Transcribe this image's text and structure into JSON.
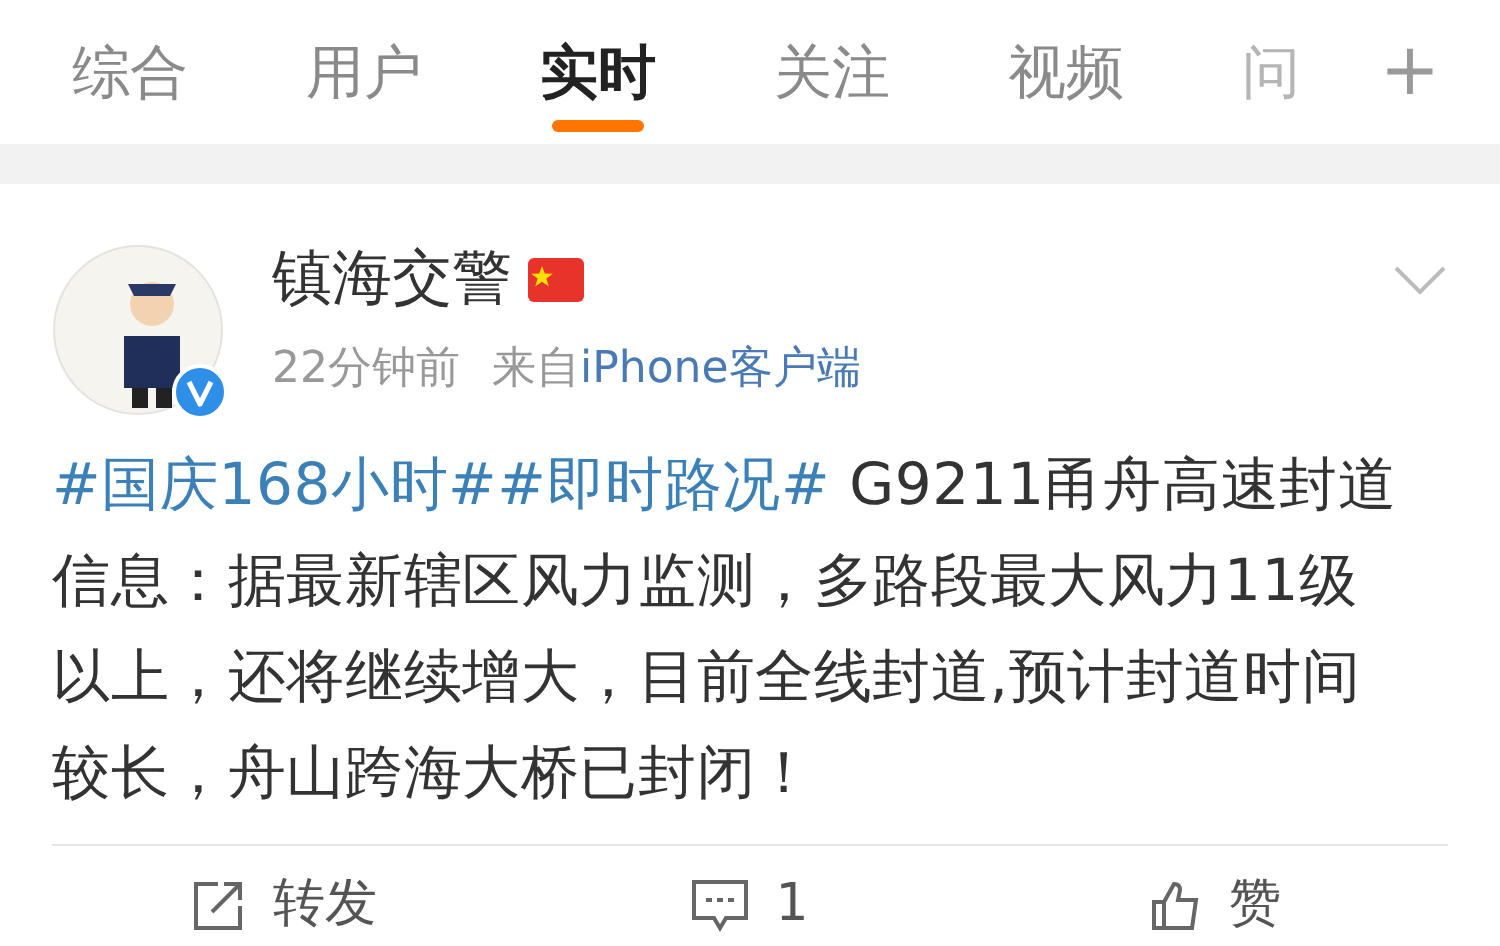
{
  "tabs": [
    {
      "label": "综合",
      "selected": false
    },
    {
      "label": "用户",
      "selected": false
    },
    {
      "label": "实时",
      "selected": true
    },
    {
      "label": "关注",
      "selected": false
    },
    {
      "label": "视频",
      "selected": false
    },
    {
      "label": "问",
      "selected": false
    }
  ],
  "add_tab": "+",
  "post": {
    "author": "镇海交警",
    "verified": true,
    "time": "22分钟前",
    "source_prefix": "来自",
    "source": "iPhone客户端",
    "body": [
      {
        "kind": "hashtag",
        "text": "#国庆168小时#"
      },
      {
        "kind": "hashtag",
        "text": "#即时路况#"
      },
      {
        "kind": "plain",
        "text": " G9211甬舟高速封道信息：据最新辖区风力监测，多路段最大风力11级以上，还将继续增大，目前全线封道,预计封道时间较长，舟山跨海大桥已封闭！"
      }
    ],
    "actions": [
      {
        "kind": "repost",
        "label": "转发"
      },
      {
        "kind": "comment",
        "label": "1"
      },
      {
        "kind": "like",
        "label": "赞"
      }
    ]
  }
}
